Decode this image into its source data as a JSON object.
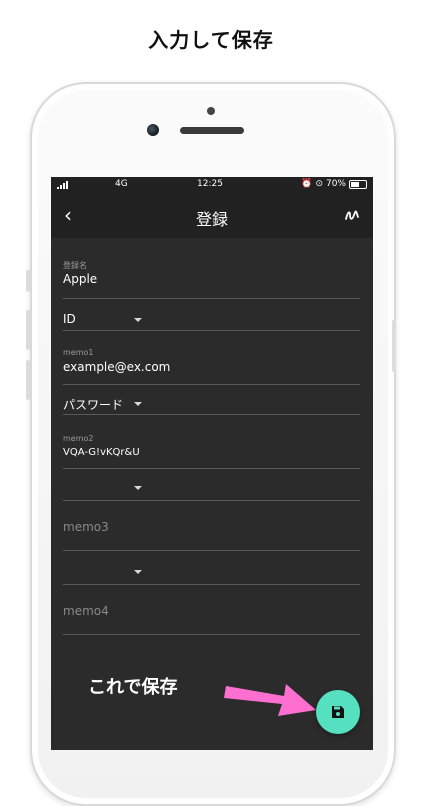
{
  "headline": "入力して保存",
  "status_bar": {
    "network": "4G",
    "time": "12:25",
    "battery": "70%",
    "battery_level": 0.7
  },
  "nav": {
    "title": "登録"
  },
  "form": {
    "name_label": "登録名",
    "name_value": "Apple",
    "id_select": "ID",
    "memo1_label": "memo1",
    "memo1_value": "example@ex.com",
    "password_select": "パスワード",
    "memo2_label": "memo2",
    "memo2_value": "VQA-G!vKQr&U",
    "memo3_placeholder": "memo3",
    "memo4_placeholder": "memo4"
  },
  "annotation": "これで保存",
  "colors": {
    "screen_bg": "#2b2b2b",
    "bar_bg": "#212121",
    "fab": "#55e0c0",
    "arrow": "#ff6fd0"
  },
  "icons": {
    "fab": "save-icon",
    "back": "chevron-left-icon",
    "generate": "scribble-icon"
  }
}
